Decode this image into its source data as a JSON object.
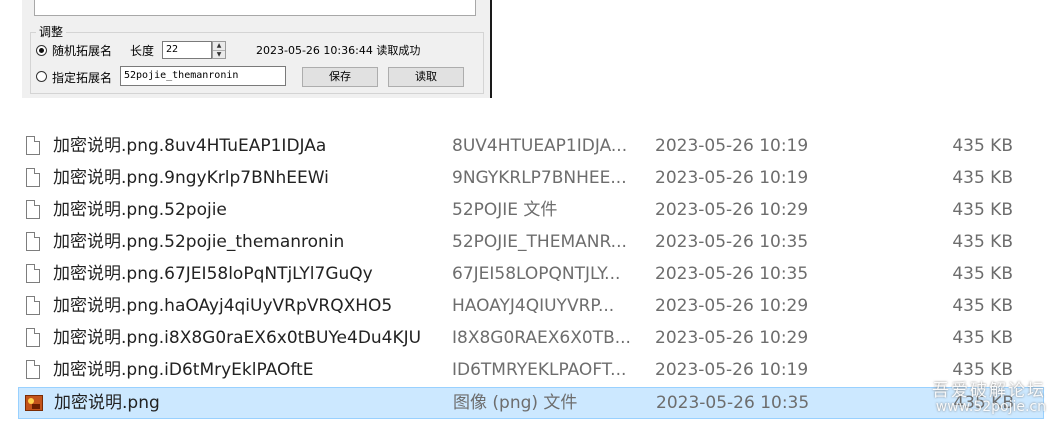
{
  "dialog": {
    "group_title": "调整",
    "random_ext_label": "随机拓展名",
    "length_label": "长度",
    "length_value": "22",
    "spin_up": "▲",
    "spin_down": "▼",
    "status_text": "2023-05-26 10:36:44 读取成功",
    "specified_ext_label": "指定拓展名",
    "specified_ext_value": "52pojie_themanronin",
    "save_button": "保存",
    "read_button": "读取"
  },
  "files": [
    {
      "name": "加密说明.png.8uv4HTuEAP1IDJAa",
      "type": "8UV4HTUEAP1IDJA...",
      "date": "2023-05-26 10:19",
      "size": "435 KB",
      "icon": "generic-file-icon"
    },
    {
      "name": "加密说明.png.9ngyKrlp7BNhEEWi",
      "type": "9NGYKRLP7BNHEE...",
      "date": "2023-05-26 10:19",
      "size": "435 KB",
      "icon": "generic-file-icon"
    },
    {
      "name": "加密说明.png.52pojie",
      "type": "52POJIE 文件",
      "date": "2023-05-26 10:29",
      "size": "435 KB",
      "icon": "generic-file-icon"
    },
    {
      "name": "加密说明.png.52pojie_themanronin",
      "type": "52POJIE_THEMANR...",
      "date": "2023-05-26 10:35",
      "size": "435 KB",
      "icon": "generic-file-icon"
    },
    {
      "name": "加密说明.png.67JEI58loPqNTjLYl7GuQy",
      "type": "67JEI58LOPQNTJLY...",
      "date": "2023-05-26 10:35",
      "size": "435 KB",
      "icon": "generic-file-icon"
    },
    {
      "name": "加密说明.png.haOAyj4qiUyVRpVRQXHO5",
      "type": "HAOAYJ4QIUYVRP...",
      "date": "2023-05-26 10:29",
      "size": "435 KB",
      "icon": "generic-file-icon"
    },
    {
      "name": "加密说明.png.i8X8G0raEX6x0tBUYe4Du4KJU",
      "type": "I8X8G0RAEX6X0TB...",
      "date": "2023-05-26 10:29",
      "size": "435 KB",
      "icon": "generic-file-icon"
    },
    {
      "name": "加密说明.png.iD6tMryEklPAOftE",
      "type": "ID6TMRYEKLPAOFT...",
      "date": "2023-05-26 10:19",
      "size": "435 KB",
      "icon": "generic-file-icon"
    },
    {
      "name": "加密说明.png",
      "type": "图像 (png) 文件",
      "date": "2023-05-26 10:35",
      "size": "435 KB",
      "icon": "image-file-icon",
      "selected": true
    }
  ],
  "watermark": {
    "line1": "吾爱破解论坛",
    "line2": "www.52pojie.cn"
  },
  "colors": {
    "selection_bg": "#cce8ff",
    "selection_border": "#99d1ff",
    "dialog_bg": "#f0f0f0"
  }
}
